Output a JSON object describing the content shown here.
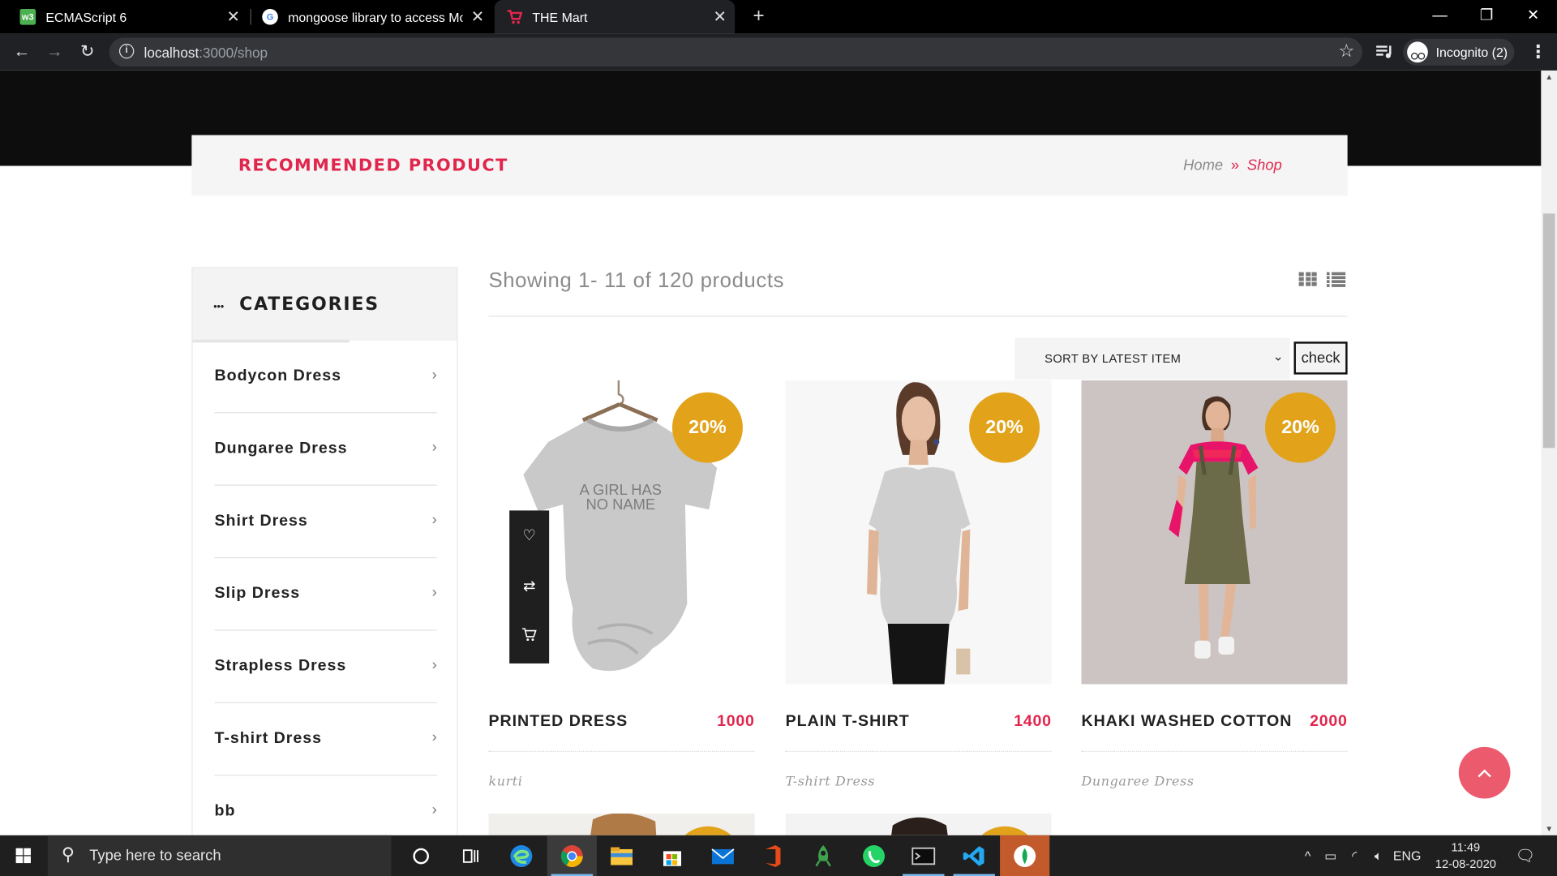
{
  "browser": {
    "tabs": [
      {
        "title": "ECMAScript 6",
        "icon": "w3schools-icon"
      },
      {
        "title": "mongoose library to access Mon",
        "icon": "google-icon"
      },
      {
        "title": "THE Mart",
        "icon": "cart-icon"
      }
    ],
    "url_host": "localhost",
    "url_path": ":3000/shop",
    "profile_label": "Incognito (2)"
  },
  "page": {
    "breadcrumb": {
      "title": "RECOMMENDED PRODUCT",
      "home": "Home",
      "current": "Shop"
    },
    "sidebar": {
      "title": "CATEGORIES",
      "items": [
        {
          "label": "Bodycon Dress"
        },
        {
          "label": "Dungaree Dress"
        },
        {
          "label": "Shirt Dress"
        },
        {
          "label": "Slip Dress"
        },
        {
          "label": "Strapless Dress"
        },
        {
          "label": "T-shirt Dress"
        },
        {
          "label": "bb"
        }
      ]
    },
    "shop": {
      "showing": "Showing 1- 11 of 120 products",
      "sort_selected": "SORT BY LATEST ITEM",
      "check_label": "check",
      "tshirt_print": "A GIRL HAS NO NAME",
      "products": [
        {
          "name": "PRINTED DRESS",
          "price": "1000",
          "category": "kurti",
          "discount": "20%"
        },
        {
          "name": "PLAIN T-SHIRT",
          "price": "1400",
          "category": "T-shirt Dress",
          "discount": "20%"
        },
        {
          "name": "KHAKI WASHED COTTON",
          "price": "2000",
          "category": "Dungaree Dress",
          "discount": "20%"
        }
      ]
    }
  },
  "taskbar": {
    "search_placeholder": "Type here to search",
    "language": "ENG",
    "time": "11:49",
    "date": "12-08-2020"
  },
  "colors": {
    "accent": "#e1264d",
    "badge": "#e2a31a",
    "scroll_top": "#ec5b6d"
  }
}
